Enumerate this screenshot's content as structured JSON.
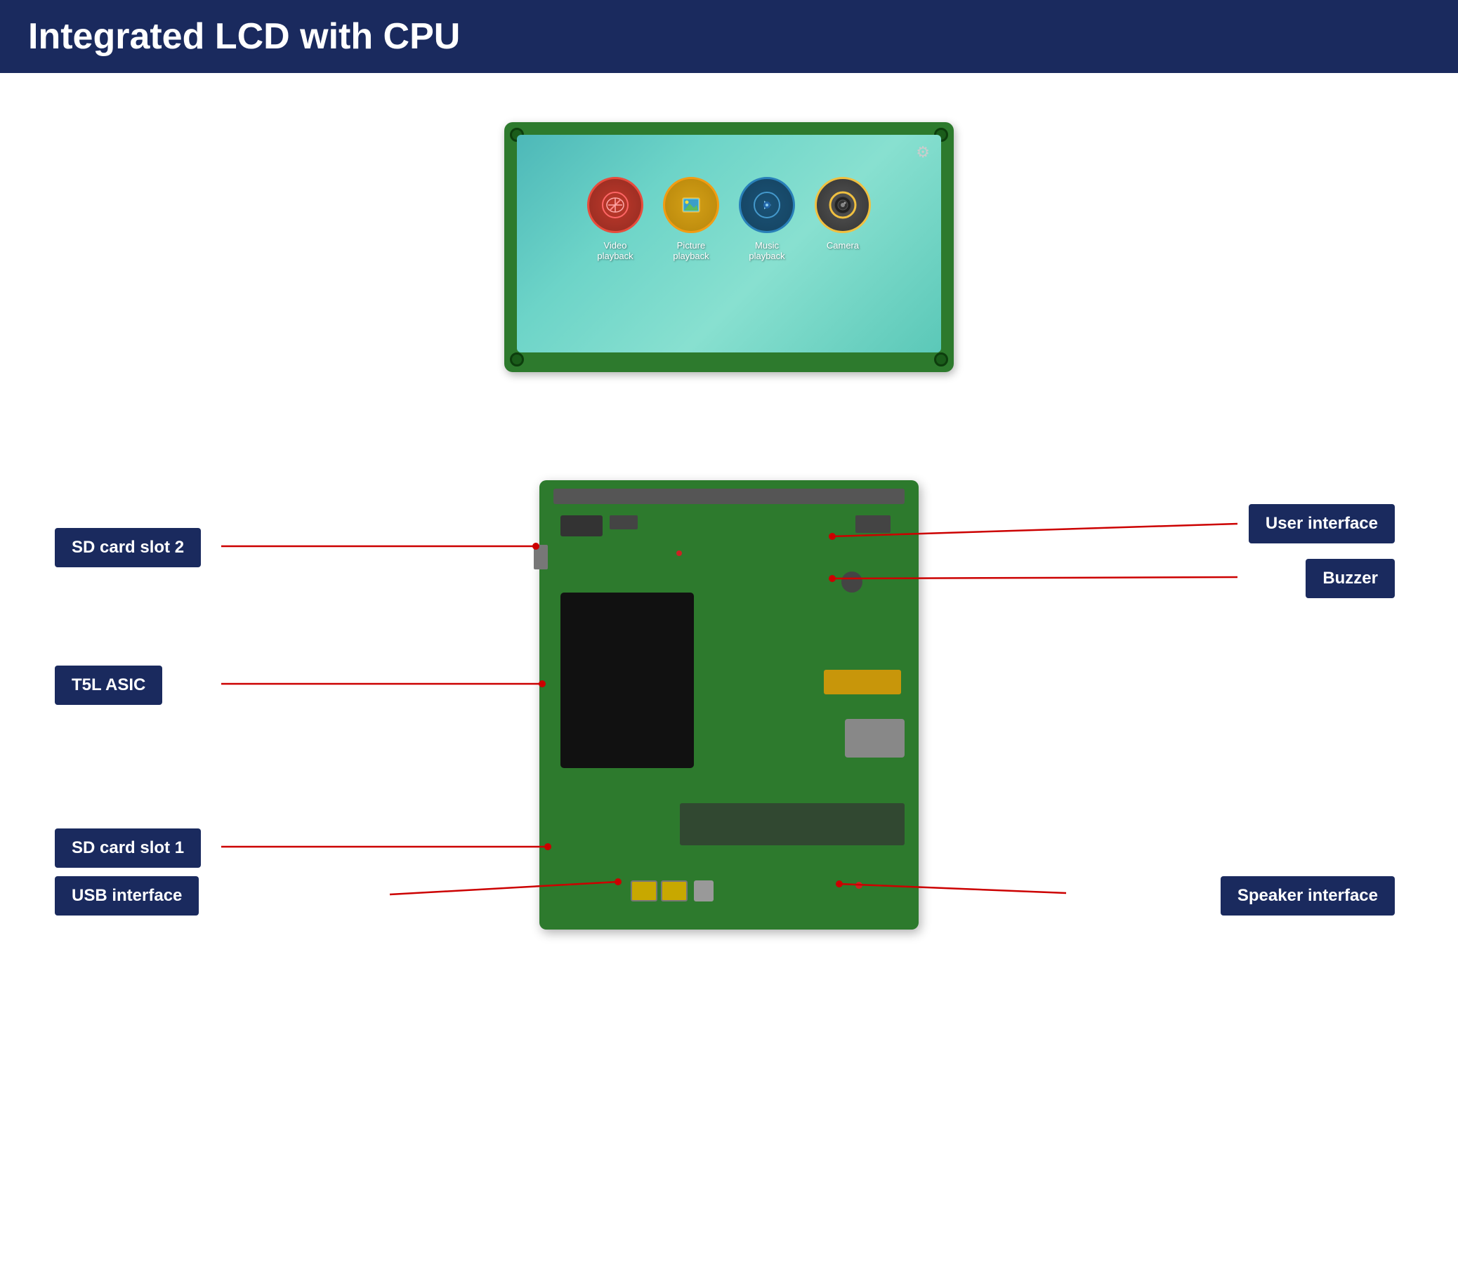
{
  "header": {
    "title": "Integrated LCD with CPU",
    "bg_color": "#1a2a5e"
  },
  "lcd_screen": {
    "apps": [
      {
        "label": "Video\nplayback",
        "icon": "🎬",
        "icon_class": "icon-video"
      },
      {
        "label": "Picture\nplayback",
        "icon": "🖼",
        "icon_class": "icon-picture"
      },
      {
        "label": "Music\nplayback",
        "icon": "🎵",
        "icon_class": "icon-music"
      },
      {
        "label": "Camera",
        "icon": "📷",
        "icon_class": "icon-camera"
      }
    ]
  },
  "labels": {
    "sd_card_slot_2": "SD card slot 2",
    "user_interface": "User interface",
    "buzzer": "Buzzer",
    "t5l_asic": "T5L ASIC",
    "sd_card_slot_1": "SD card slot 1",
    "usb_interface": "USB interface",
    "speaker_interface": "Speaker interface"
  }
}
